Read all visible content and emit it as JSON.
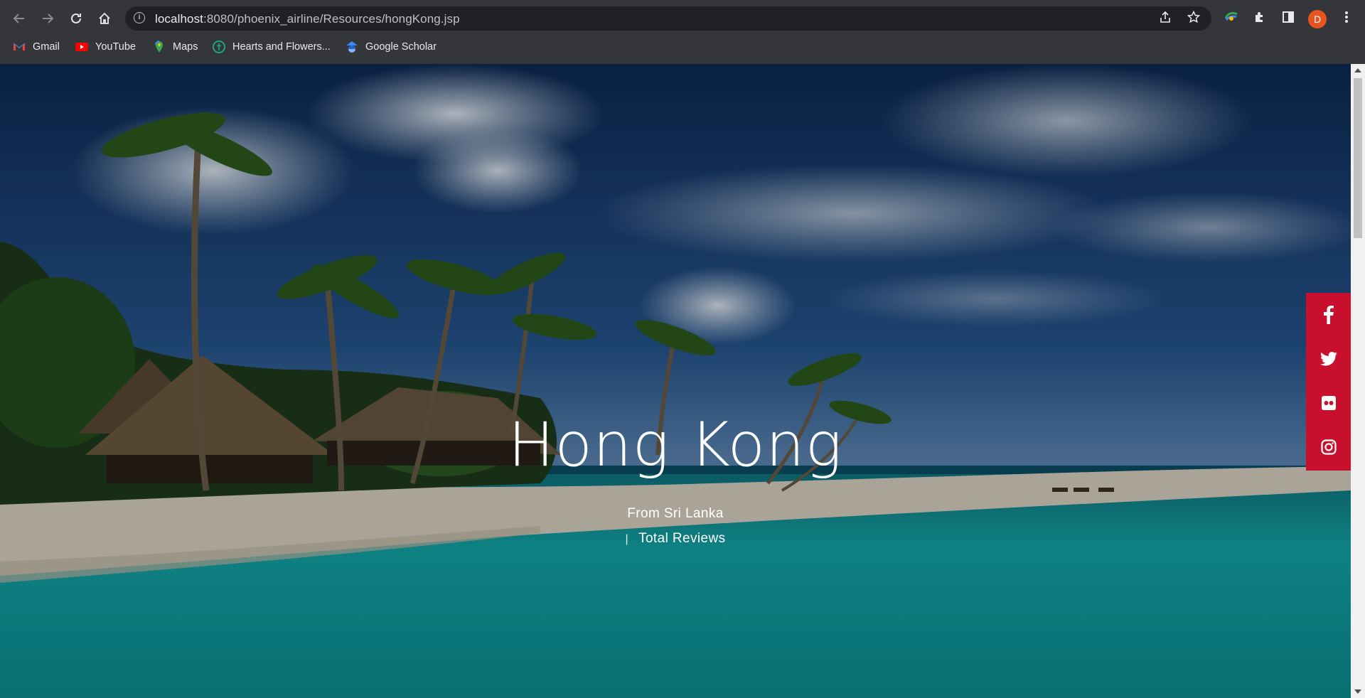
{
  "browser": {
    "url_host": "localhost",
    "url_rest": ":8080/phoenix_airline/Resources/hongKong.jsp",
    "profile_initial": "D",
    "bookmarks": [
      {
        "label": "Gmail",
        "icon": "gmail-icon"
      },
      {
        "label": "YouTube",
        "icon": "youtube-icon"
      },
      {
        "label": "Maps",
        "icon": "maps-icon"
      },
      {
        "label": "Hearts and Flowers...",
        "icon": "hearts-flowers-icon"
      },
      {
        "label": "Google Scholar",
        "icon": "google-scholar-icon"
      }
    ]
  },
  "hero": {
    "title": "Hong Kong",
    "from": "From Sri Lanka",
    "reviews_separator": "|",
    "reviews": "Total Reviews",
    "background": "tropical-beach-palm-trees"
  },
  "social": [
    {
      "name": "facebook",
      "icon": "facebook-icon"
    },
    {
      "name": "twitter",
      "icon": "twitter-icon"
    },
    {
      "name": "flickr",
      "icon": "flickr-icon"
    },
    {
      "name": "instagram",
      "icon": "instagram-icon"
    }
  ],
  "colors": {
    "social_bar": "#c8102e",
    "chrome": "#35363a",
    "omnibox": "#202124",
    "profile": "#e8541f"
  }
}
